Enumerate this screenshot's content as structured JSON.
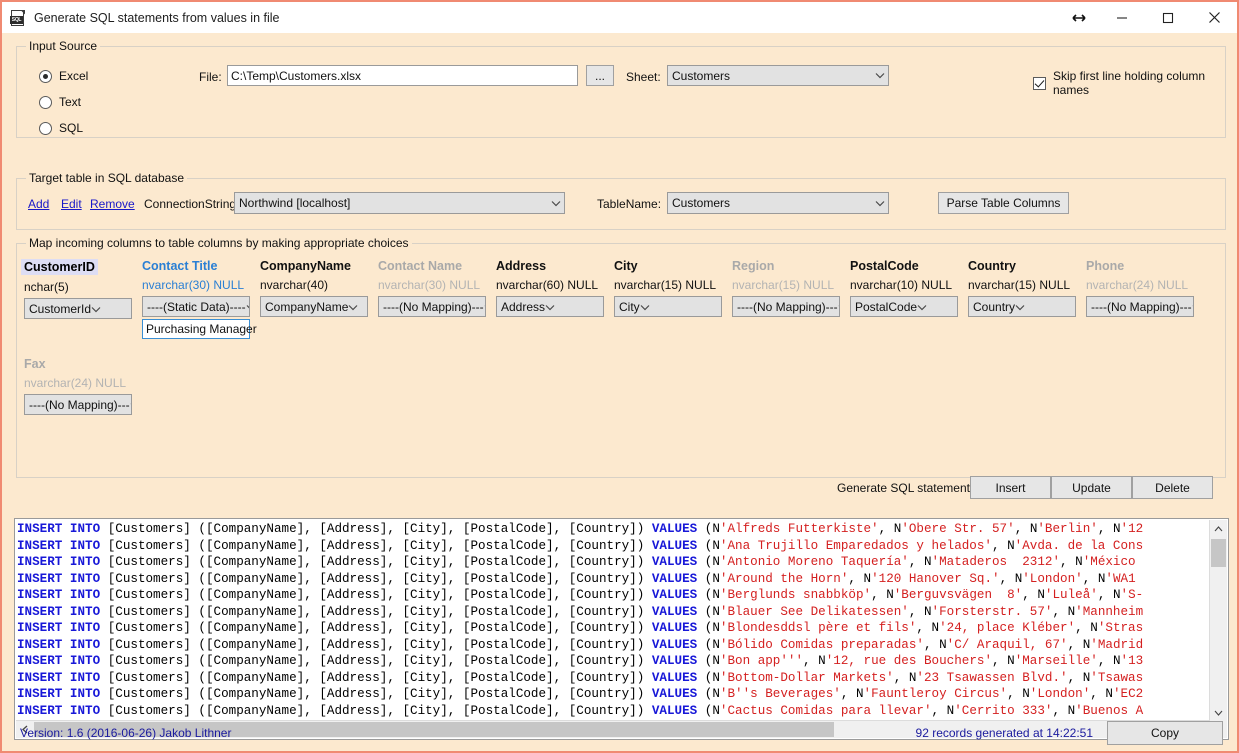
{
  "window": {
    "title": "Generate SQL statements from values in file",
    "icon": "sql-document-icon",
    "buttons": {
      "resize": "↔",
      "minimize": "minimize-icon",
      "maximize": "maximize-icon",
      "close": "close-icon"
    },
    "accent_border": "#f08a72",
    "client_bg": "#fce9cf"
  },
  "input_source": {
    "group_title": "Input Source",
    "radios": [
      {
        "label": "Excel",
        "checked": true
      },
      {
        "label": "Text",
        "checked": false
      },
      {
        "label": "SQL",
        "checked": false
      }
    ],
    "file_label": "File:",
    "file_value": "C:\\Temp\\Customers.xlsx",
    "browse_label": "...",
    "sheet_label": "Sheet:",
    "sheet_value": "Customers",
    "skip_first_line": {
      "label": "Skip first line holding column names",
      "checked": true
    }
  },
  "target_table": {
    "group_title": "Target table in SQL database",
    "links": {
      "add": "Add",
      "edit": "Edit",
      "remove": "Remove"
    },
    "connection_label": "ConnectionString:",
    "connection_value": "Northwind   [localhost]",
    "tablename_label": "TableName:",
    "tablename_value": "Customers",
    "parse_button": "Parse Table Columns"
  },
  "mapping": {
    "group_title": "Map incoming columns to table columns by making appropriate choices",
    "columns": [
      {
        "name": "CustomerID",
        "type": "nchar(5)",
        "style": "pk",
        "mapping": "CustomerId",
        "static_value": null
      },
      {
        "name": "Contact Title",
        "type": "nvarchar(30)  NULL",
        "style": "linkish",
        "mapping": "----(Static Data)----",
        "static_value": "Purchasing Manager"
      },
      {
        "name": "CompanyName",
        "type": "nvarchar(40)",
        "style": "active",
        "mapping": "CompanyName",
        "static_value": null
      },
      {
        "name": "Contact Name",
        "type": "nvarchar(30)  NULL",
        "style": "disabled",
        "mapping": "----(No Mapping)---",
        "static_value": null
      },
      {
        "name": "Address",
        "type": "nvarchar(60)  NULL",
        "style": "active",
        "mapping": "Address",
        "static_value": null
      },
      {
        "name": "City",
        "type": "nvarchar(15)  NULL",
        "style": "active",
        "mapping": "City",
        "static_value": null
      },
      {
        "name": "Region",
        "type": "nvarchar(15)  NULL",
        "style": "disabled",
        "mapping": "----(No Mapping)---",
        "static_value": null
      },
      {
        "name": "PostalCode",
        "type": "nvarchar(10)  NULL",
        "style": "active",
        "mapping": "PostalCode",
        "static_value": null
      },
      {
        "name": "Country",
        "type": "nvarchar(15)  NULL",
        "style": "active",
        "mapping": "Country",
        "static_value": null
      },
      {
        "name": "Phone",
        "type": "nvarchar(24)  NULL",
        "style": "disabled",
        "mapping": "----(No Mapping)---",
        "static_value": null
      },
      {
        "name": "Fax",
        "type": "nvarchar(24)  NULL",
        "style": "disabled",
        "mapping": "----(No Mapping)---",
        "static_value": null
      }
    ],
    "generate_label": "Generate SQL statements:",
    "buttons": {
      "insert": "Insert",
      "update": "Update",
      "delete": "Delete"
    }
  },
  "sql_output": {
    "prefix": "INSERT INTO [Customers] ([CompanyName], [Address], [City], [PostalCode], [Country]) VALUES (",
    "keywords": [
      "INSERT",
      "INTO",
      "VALUES"
    ],
    "colors": {
      "keyword": "#1818d8",
      "string": "#d42020",
      "normal": "#000000"
    },
    "lines": [
      "N'Alfreds Futterkiste', N'Obere Str. 57', N'Berlin', N'12",
      "N'Ana Trujillo Emparedados y helados', N'Avda. de la Cons",
      "N'Antonio Moreno Taquería', N'Mataderos  2312', N'México",
      "N'Around the Horn', N'120 Hanover Sq.', N'London', N'WA1",
      "N'Berglunds snabbköp', N'Berguvsvägen  8', N'Luleå', N'S-",
      "N'Blauer See Delikatessen', N'Forsterstr. 57', N'Mannheim",
      "N'Blondesddsl père et fils', N'24, place Kléber', N'Stras",
      "N'Bólido Comidas preparadas', N'C/ Araquil, 67', N'Madrid",
      "N'Bon app''', N'12, rue des Bouchers', N'Marseille', N'13",
      "N'Bottom-Dollar Markets', N'23 Tsawassen Blvd.', N'Tsawas",
      "N'B''s Beverages', N'Fauntleroy Circus', N'London', N'EC2",
      "N'Cactus Comidas para llevar', N'Cerrito 333', N'Buenos A"
    ],
    "partial_line_count": 13
  },
  "status": {
    "version": "Version: 1.6  (2016-06-26)  Jakob Lithner",
    "records": "92 records generated at 14:22:51",
    "copy_button": "Copy"
  }
}
